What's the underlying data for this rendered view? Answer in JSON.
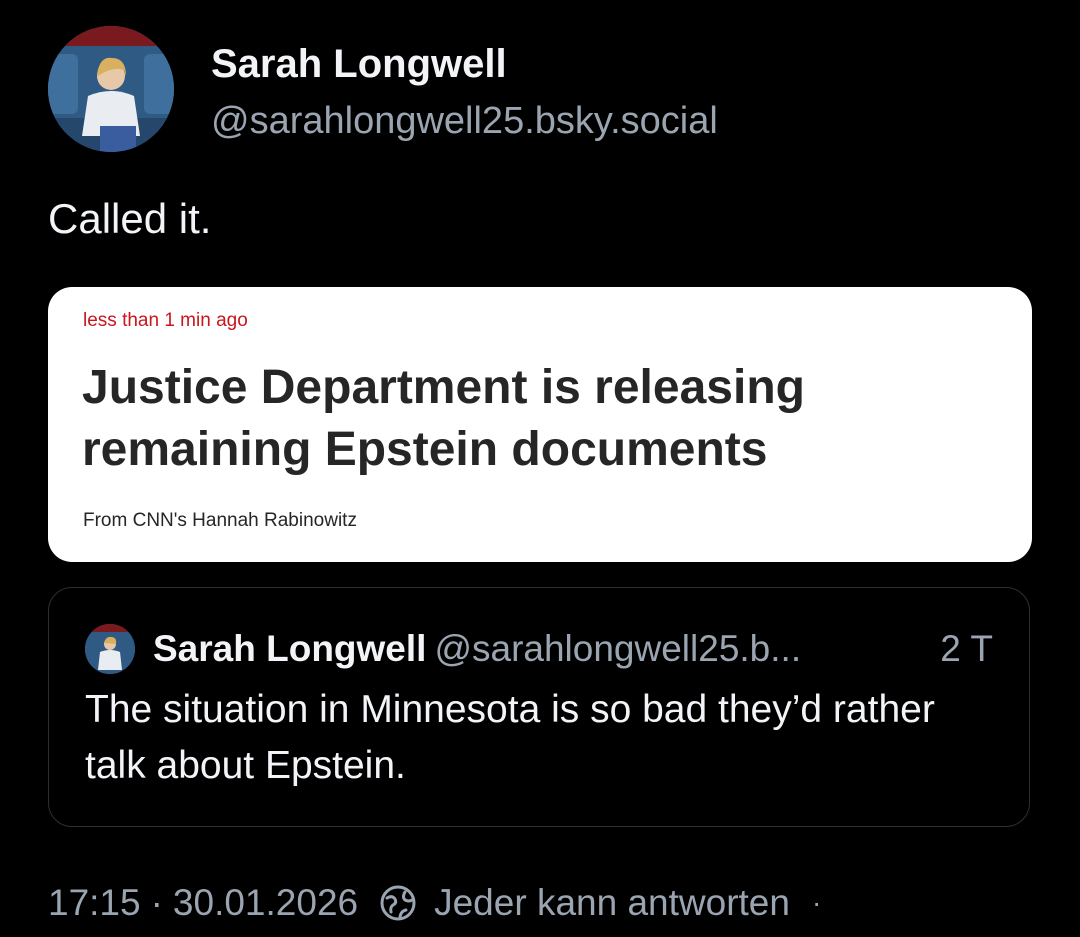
{
  "author": {
    "display_name": "Sarah Longwell",
    "handle": "@sarahlongwell25.bsky.social"
  },
  "post": {
    "text": "Called it."
  },
  "embed_image": {
    "timestamp": "less than 1 min ago",
    "headline": "Justice Department is releasing remaining Epstein documents",
    "byline": "From CNN's Hannah Rabinowitz"
  },
  "quoted_post": {
    "display_name": "Sarah Longwell",
    "handle": "@sarahlongwell25.b...",
    "age": "2 T",
    "text": "The situation in Minnesota is so bad they’d rather talk about Epstein."
  },
  "footer": {
    "time": "17:15",
    "separator": "·",
    "date": "30.01.2026",
    "reply_setting": "Jeder kann antworten",
    "trailing_dot": "·"
  },
  "icons": {
    "reply_setting": "globe-icon"
  },
  "colors": {
    "background": "#000000",
    "primary_text": "#f2f4f7",
    "secondary_text": "#9aa5b1",
    "embed_timestamp": "#c9151e",
    "quote_border": "#2b2f36"
  }
}
